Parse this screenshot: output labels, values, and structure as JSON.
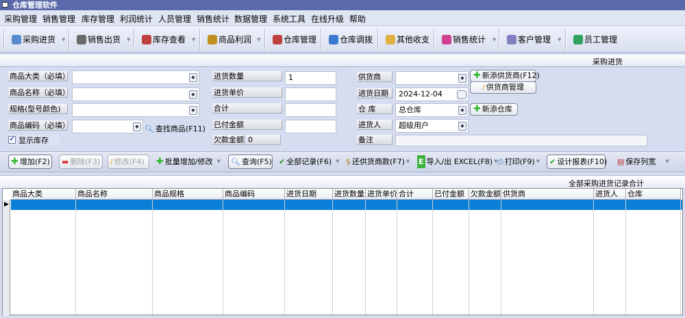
{
  "app": {
    "title": "仓库管理软件"
  },
  "menu": [
    "采购管理",
    "销售管理",
    "库存管理",
    "利润统计",
    "人员管理",
    "销售统计",
    "数据管理",
    "系统工具",
    "在线升级",
    "帮助"
  ],
  "toolbar": [
    {
      "label": "采购进货",
      "icon": "purchase-icon",
      "dropdown": true
    },
    {
      "label": "销售出货",
      "icon": "sales-icon",
      "dropdown": true
    },
    {
      "label": "库存查看",
      "icon": "inventory-icon",
      "dropdown": true
    },
    {
      "label": "商品利润",
      "icon": "money-bag-icon",
      "dropdown": true
    },
    {
      "label": "仓库管理",
      "icon": "warehouse-icon",
      "dropdown": false
    },
    {
      "label": "仓库调拨",
      "icon": "transfer-icon",
      "dropdown": false
    },
    {
      "label": "其他收支",
      "icon": "ledger-icon",
      "dropdown": false
    },
    {
      "label": "销售统计",
      "icon": "chart-icon",
      "dropdown": true
    },
    {
      "label": "客户管理",
      "icon": "customer-icon",
      "dropdown": true
    },
    {
      "label": "员工管理",
      "icon": "staff-icon",
      "dropdown": false
    }
  ],
  "section_title": "采购进货",
  "form": {
    "category_label": "商品大类（必填）",
    "category_value": "",
    "name_label": "商品名称（必填）",
    "name_value": "",
    "spec_label": "规格(型号颜色)",
    "spec_value": "",
    "code_label": "商品编码（必填）",
    "code_value": "",
    "find_product": "查找商品(F11)",
    "show_stock_label": "显示库存",
    "show_stock_checked": true,
    "qty_label": "进货数量",
    "qty_value": "1",
    "price_label": "进货单价",
    "price_value": "",
    "total_label": "合计",
    "total_value": "",
    "paid_label": "已付金额",
    "paid_value": "",
    "owed_label": "欠款金额",
    "owed_value": "0",
    "supplier_label": "供货商",
    "supplier_value": "",
    "date_label": "进货日期",
    "date_value": "2024-12-04",
    "warehouse_label": "仓 库",
    "warehouse_value": "总仓库",
    "buyer_label": "进货人",
    "buyer_value": "超级用户",
    "note_label": "备注",
    "note_value": "",
    "add_supplier": "新添供货商(F12)",
    "manage_supplier": "供货商管理",
    "add_warehouse": "新添仓库"
  },
  "actions": {
    "add": "增加(F2)",
    "delete": "删除(F3)",
    "edit": "修改(F4)",
    "batch": "批量增加/修改",
    "query": "查询(F5)",
    "all": "全部记录(F6)",
    "repay": "还供货商款(F7)",
    "excel": "导入/出 EXCEL(F8)",
    "print": "打印(F9)",
    "design": "设计报表(F10)",
    "save_width": "保存列宽"
  },
  "summary": "全部采购进货记录合计",
  "table": {
    "columns": [
      "商品大类",
      "商品名称",
      "商品规格",
      "商品编码",
      "进货日期",
      "进货数量",
      "进货单价",
      "合计",
      "已付金额",
      "欠款金额",
      "供货商",
      "进货人",
      "仓库"
    ],
    "rows": []
  },
  "colors": {
    "title_bar": "#5a69ab",
    "selection": "#0a7fd8"
  }
}
